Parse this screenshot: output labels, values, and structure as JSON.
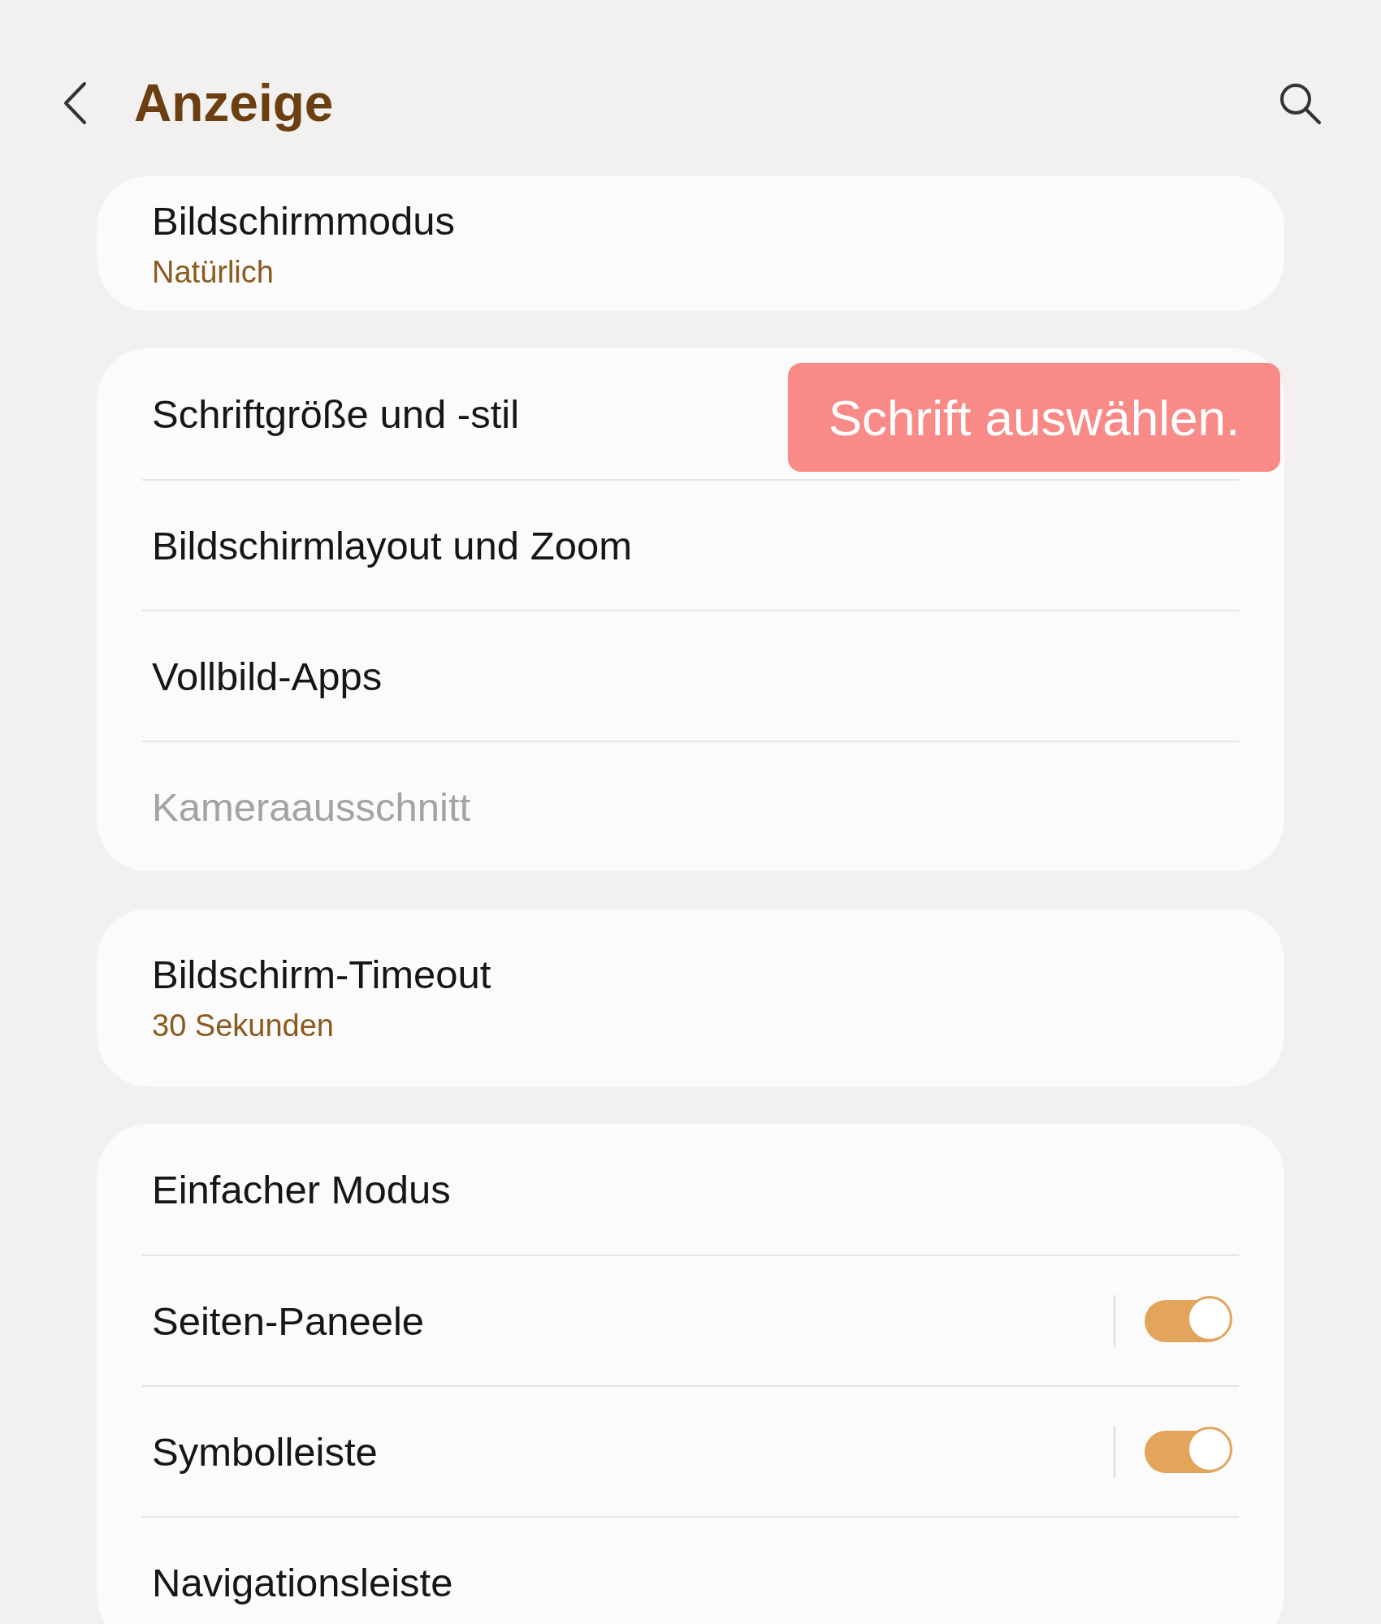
{
  "header": {
    "title": "Anzeige"
  },
  "groups": [
    {
      "rows": [
        {
          "kind": "value",
          "title": "Bildschirmmodus",
          "value": "Natürlich",
          "disabled": false
        }
      ]
    },
    {
      "rows": [
        {
          "kind": "plain",
          "title": "Schriftgröße und -stil",
          "disabled": false
        },
        {
          "kind": "plain",
          "title": "Bildschirmlayout und Zoom",
          "disabled": false
        },
        {
          "kind": "plain",
          "title": "Vollbild-Apps",
          "disabled": false
        },
        {
          "kind": "plain",
          "title": "Kameraausschnitt",
          "disabled": true
        }
      ],
      "callout": {
        "text": "Schrift auswählen."
      }
    },
    {
      "rows": [
        {
          "kind": "value",
          "title": "Bildschirm-Timeout",
          "value": "30 Sekunden",
          "disabled": false
        }
      ]
    },
    {
      "rows": [
        {
          "kind": "plain",
          "title": "Einfacher Modus",
          "disabled": false
        },
        {
          "kind": "switch",
          "title": "Seiten-Paneele",
          "on": true,
          "disabled": false
        },
        {
          "kind": "switch",
          "title": "Symbolleiste",
          "on": true,
          "disabled": false
        },
        {
          "kind": "plain",
          "title": "Navigationsleiste",
          "disabled": false
        }
      ]
    }
  ]
}
